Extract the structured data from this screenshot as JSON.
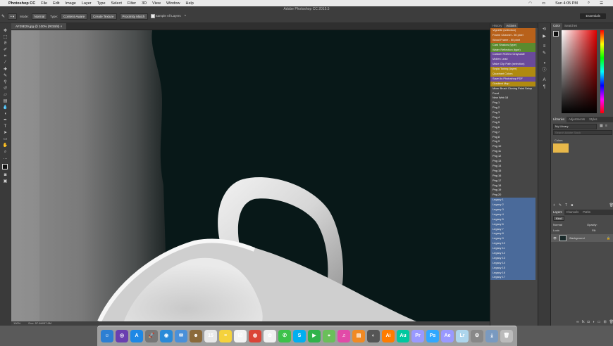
{
  "menubar": {
    "apple": "",
    "app_name": "Photoshop CC",
    "items": [
      "File",
      "Edit",
      "Image",
      "Layer",
      "Type",
      "Select",
      "Filter",
      "3D",
      "View",
      "Window",
      "Help"
    ],
    "clock": "Sun 4:05 PM"
  },
  "window": {
    "title": "Adobe Photoshop CC 2015.5"
  },
  "options_bar": {
    "mode_label": "Mode:",
    "mode_value": "Normal",
    "type_label": "Type:",
    "type_options": [
      "Content-Aware",
      "Create Texture",
      "Proximity Match"
    ],
    "sample_all_layers": "Sample All Layers",
    "workspace": "Essentials"
  },
  "document": {
    "tab_title": "AF29E29.jpg @ 100% (RGB/8)",
    "zoom": "100%",
    "doc_size": "Doc: 57.6M/57.6M"
  },
  "actions_panel": {
    "tabs": [
      "History",
      "Actions"
    ],
    "items": [
      {
        "label": "Vignette (selection)",
        "color": "#b8611a"
      },
      {
        "label": "Frame Channel - 50 pixel",
        "color": "#b8611a"
      },
      {
        "label": "Wood Frame - 50 pixel",
        "color": "#b8611a"
      },
      {
        "label": "Cast Shadow (type)",
        "color": "#5a8a2e"
      },
      {
        "label": "Water Reflection (type)",
        "color": "#5a8a2e"
      },
      {
        "label": "Custom RGB to Grayscale",
        "color": "#6a4a9a"
      },
      {
        "label": "Molten Lead",
        "color": "#6a4a9a"
      },
      {
        "label": "Make Clip Path (selection)",
        "color": "#6a4a9a"
      },
      {
        "label": "Sepia Toning (layer)",
        "color": "#b08a10"
      },
      {
        "label": "Quadrant Colors",
        "color": "#b08a10"
      },
      {
        "label": "Save As Photoshop PDF",
        "color": "#6a4a9a"
      },
      {
        "label": "Gradient Map",
        "color": "#b08a10"
      },
      {
        "label": "Mixer Brush Cloning Paint Setup",
        "color": ""
      },
      {
        "label": "Food",
        "color": ""
      },
      {
        "label": "New Web 18",
        "color": ""
      },
      {
        "label": "Png 1",
        "color": ""
      },
      {
        "label": "Png 2",
        "color": ""
      },
      {
        "label": "Png 3",
        "color": ""
      },
      {
        "label": "Png 4",
        "color": ""
      },
      {
        "label": "Png 5",
        "color": ""
      },
      {
        "label": "Png 6",
        "color": ""
      },
      {
        "label": "Png 7",
        "color": ""
      },
      {
        "label": "Png 8",
        "color": ""
      },
      {
        "label": "Png 9",
        "color": ""
      },
      {
        "label": "Png 10",
        "color": ""
      },
      {
        "label": "Png 11",
        "color": ""
      },
      {
        "label": "Png 12",
        "color": ""
      },
      {
        "label": "Png 13",
        "color": ""
      },
      {
        "label": "Png 14",
        "color": ""
      },
      {
        "label": "Png 15",
        "color": ""
      },
      {
        "label": "Png 16",
        "color": ""
      },
      {
        "label": "Png 17",
        "color": ""
      },
      {
        "label": "Png 18",
        "color": ""
      },
      {
        "label": "Png 19",
        "color": ""
      },
      {
        "label": "Png 20",
        "color": ""
      },
      {
        "label": "Legacy 1",
        "color": "#4a6a9a"
      },
      {
        "label": "Legacy 2",
        "color": "#4a6a9a"
      },
      {
        "label": "Legacy 3",
        "color": "#4a6a9a"
      },
      {
        "label": "Legacy 4",
        "color": "#4a6a9a"
      },
      {
        "label": "Legacy 5",
        "color": "#4a6a9a"
      },
      {
        "label": "Legacy 6",
        "color": "#4a6a9a"
      },
      {
        "label": "Legacy 7",
        "color": "#4a6a9a"
      },
      {
        "label": "Legacy 8",
        "color": "#4a6a9a"
      },
      {
        "label": "Legacy 9",
        "color": "#4a6a9a"
      },
      {
        "label": "Legacy 10",
        "color": "#4a6a9a"
      },
      {
        "label": "Legacy 11",
        "color": "#4a6a9a"
      },
      {
        "label": "Legacy 12",
        "color": "#4a6a9a"
      },
      {
        "label": "Legacy 13",
        "color": "#4a6a9a"
      },
      {
        "label": "Legacy 14",
        "color": "#4a6a9a"
      },
      {
        "label": "Legacy 15",
        "color": "#4a6a9a"
      },
      {
        "label": "Legacy 16",
        "color": "#4a6a9a"
      },
      {
        "label": "Legacy 17",
        "color": "#4a6a9a"
      }
    ]
  },
  "color_panel": {
    "tabs": [
      "Color",
      "Swatches"
    ]
  },
  "libraries_panel": {
    "tabs": [
      "Libraries",
      "Adjustments",
      "Styles"
    ],
    "library_name": "My Library",
    "search_placeholder": "Search Adobe Stock",
    "section": "Colors",
    "swatch_color": "#e8b84a"
  },
  "layers_panel": {
    "tabs": [
      "Layers",
      "Channels",
      "Paths"
    ],
    "kind_label": "Kind",
    "blend_mode": "Normal",
    "opacity_label": "Opacity:",
    "fill_label": "Fill:",
    "lock_label": "Lock:",
    "layer_name": "Background"
  },
  "dock": {
    "apps": [
      {
        "name": "Finder",
        "glyph": "☺",
        "color": "#2d7fd3"
      },
      {
        "name": "Siri",
        "glyph": "◎",
        "color": "#6a3fb0"
      },
      {
        "name": "App Store",
        "glyph": "A",
        "color": "#1e88e5"
      },
      {
        "name": "Launchpad",
        "glyph": "🚀",
        "color": "#777"
      },
      {
        "name": "Safari",
        "glyph": "◉",
        "color": "#2a8ad8"
      },
      {
        "name": "Mail",
        "glyph": "✉",
        "color": "#4a90d9"
      },
      {
        "name": "Contacts",
        "glyph": "☻",
        "color": "#8b6a3a"
      },
      {
        "name": "Calendar",
        "glyph": "15",
        "color": "#e8e8e8"
      },
      {
        "name": "Notes",
        "glyph": "≡",
        "color": "#f5d23c"
      },
      {
        "name": "Reminders",
        "glyph": "☑",
        "color": "#f3f3f3"
      },
      {
        "name": "Chrome",
        "glyph": "◍",
        "color": "#db4437"
      },
      {
        "name": "Photos",
        "glyph": "✿",
        "color": "#f0f0f0"
      },
      {
        "name": "Messages",
        "glyph": "✆",
        "color": "#3cc24a"
      },
      {
        "name": "Skype",
        "glyph": "S",
        "color": "#00aff0"
      },
      {
        "name": "FaceTime",
        "glyph": "▶",
        "color": "#2fb34a"
      },
      {
        "name": "Maps",
        "glyph": "⌖",
        "color": "#6abf5a"
      },
      {
        "name": "iTunes",
        "glyph": "♫",
        "color": "#e24aa8"
      },
      {
        "name": "iBooks",
        "glyph": "▤",
        "color": "#f08a24"
      },
      {
        "name": "Dashboard",
        "glyph": "◐",
        "color": "#555"
      },
      {
        "name": "Illustrator",
        "glyph": "Ai",
        "color": "#ff7c00"
      },
      {
        "name": "Audition",
        "glyph": "Au",
        "color": "#00c8a0"
      },
      {
        "name": "Premiere",
        "glyph": "Pr",
        "color": "#9999ff"
      },
      {
        "name": "Photoshop",
        "glyph": "Ps",
        "color": "#31a8ff"
      },
      {
        "name": "After Effects",
        "glyph": "Ae",
        "color": "#9999ff"
      },
      {
        "name": "Lightroom",
        "glyph": "Lr",
        "color": "#add5ec"
      },
      {
        "name": "System Preferences",
        "glyph": "⚙",
        "color": "#888"
      },
      {
        "name": "Downloads",
        "glyph": "⤓",
        "color": "#7a9ac0"
      },
      {
        "name": "Trash",
        "glyph": "🗑",
        "color": "#bbb"
      }
    ]
  }
}
